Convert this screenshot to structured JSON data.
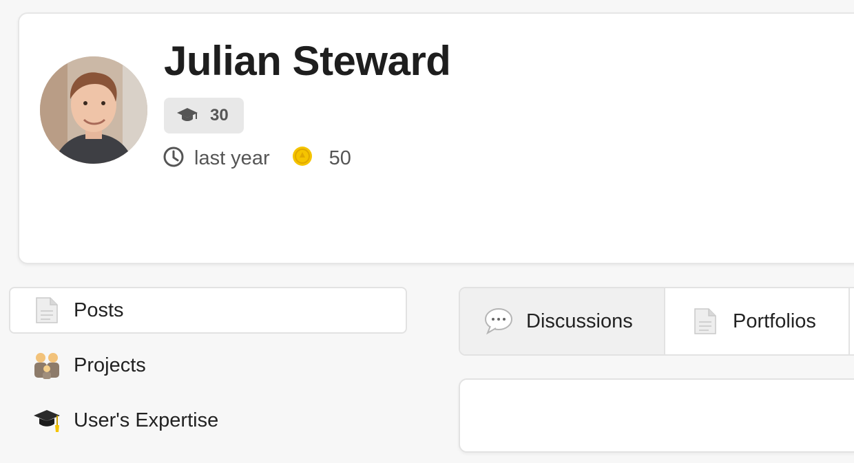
{
  "profile": {
    "name": "Julian Steward",
    "level": "30",
    "last_seen": "last year",
    "coins": "50"
  },
  "nav": {
    "items": [
      {
        "label": "Posts",
        "icon": "document-icon",
        "active": true
      },
      {
        "label": "Projects",
        "icon": "people-icon",
        "active": false
      },
      {
        "label": "User's Expertise",
        "icon": "graduation-cap-icon",
        "active": false
      }
    ]
  },
  "tabs": [
    {
      "label": "Discussions",
      "icon": "speech-bubble-icon",
      "active": true
    },
    {
      "label": "Portfolios",
      "icon": "document-icon",
      "active": false
    }
  ],
  "colors": {
    "badge_bg": "#e8e8e8",
    "coin": "#f5c400",
    "active_tab_bg": "#f0f0f0"
  }
}
